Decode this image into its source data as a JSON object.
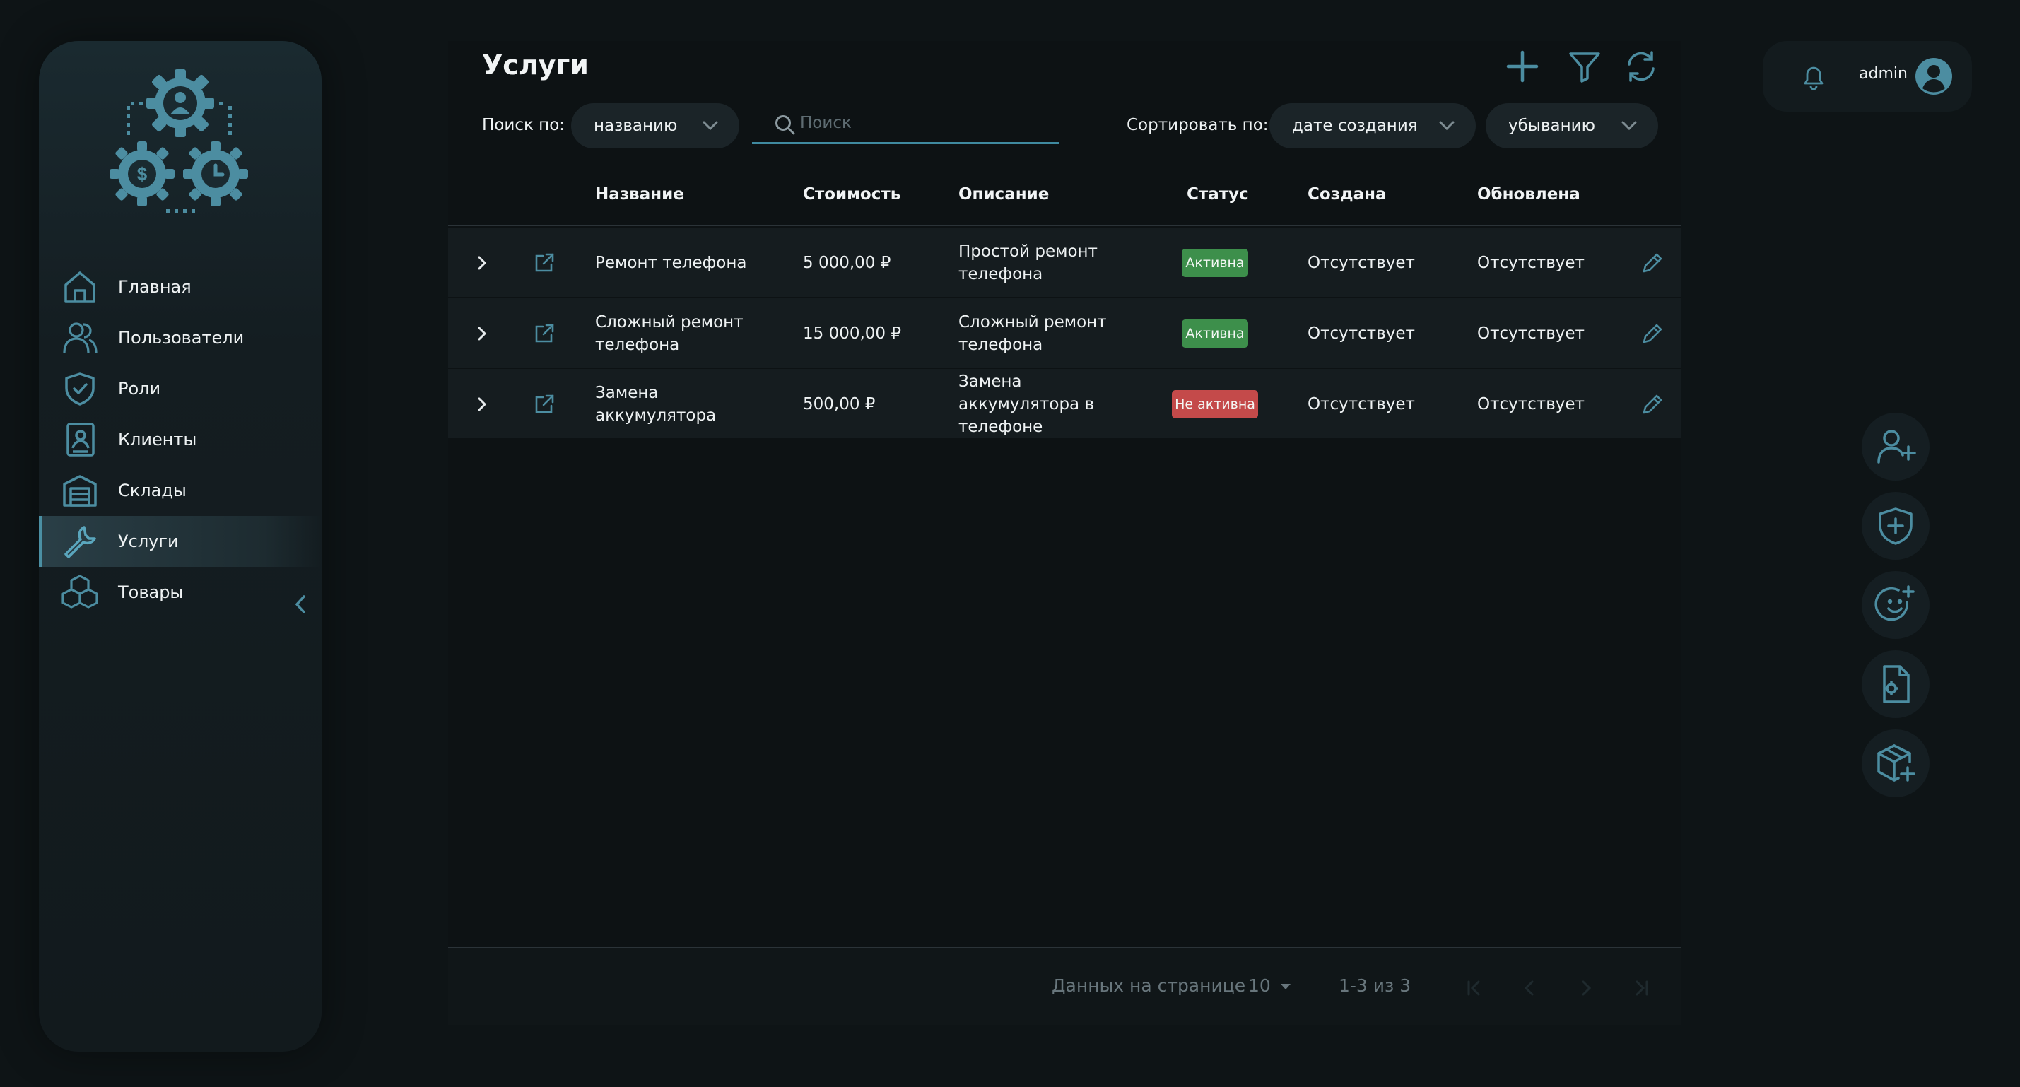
{
  "sidebar": {
    "items": [
      {
        "label": "Главная",
        "icon": "home-icon"
      },
      {
        "label": "Пользователи",
        "icon": "users-icon"
      },
      {
        "label": "Роли",
        "icon": "shield-check-icon"
      },
      {
        "label": "Клиенты",
        "icon": "contact-book-icon"
      },
      {
        "label": "Склады",
        "icon": "warehouse-icon"
      },
      {
        "label": "Услуги",
        "icon": "wrench-icon",
        "active": true
      },
      {
        "label": "Товары",
        "icon": "cubes-icon"
      }
    ]
  },
  "header": {
    "title": "Услуги"
  },
  "filters": {
    "search_by_label": "Поиск по:",
    "search_by_value": "названию",
    "search_placeholder": "Поиск",
    "sort_by_label": "Сортировать по:",
    "sort_by_value": "дате создания",
    "sort_order_value": "убыванию"
  },
  "table": {
    "columns": [
      "Название",
      "Стоимость",
      "Описание",
      "Статус",
      "Создана",
      "Обновлена"
    ],
    "rows": [
      {
        "name": [
          "Ремонт телефона"
        ],
        "price": "5 000,00 ₽",
        "description": [
          "Простой ремонт",
          "телефона"
        ],
        "status": "Активна",
        "active": true,
        "created": "Отсутствует",
        "updated": "Отсутствует"
      },
      {
        "name": [
          "Сложный ремонт",
          "телефона"
        ],
        "price": "15 000,00 ₽",
        "description": [
          "Сложный ремонт",
          "телефона"
        ],
        "status": "Активна",
        "active": true,
        "created": "Отсутствует",
        "updated": "Отсутствует"
      },
      {
        "name": [
          "Замена",
          "аккумулятора"
        ],
        "price": "500,00 ₽",
        "description": [
          "Замена",
          "аккумулятора в",
          "телефоне"
        ],
        "status": "Не активна",
        "active": false,
        "created": "Отсутствует",
        "updated": "Отсутствует"
      }
    ]
  },
  "pagination": {
    "rows_per_page_label": "Данных на странице",
    "rows_per_page_value": "10",
    "range": "1-3 из 3"
  },
  "user": {
    "name": "admin"
  },
  "colors": {
    "background": "#0e1416",
    "accent": "#4b8fa3",
    "active_badge": "#3d8f4b",
    "inactive_badge": "#c44a4a"
  }
}
